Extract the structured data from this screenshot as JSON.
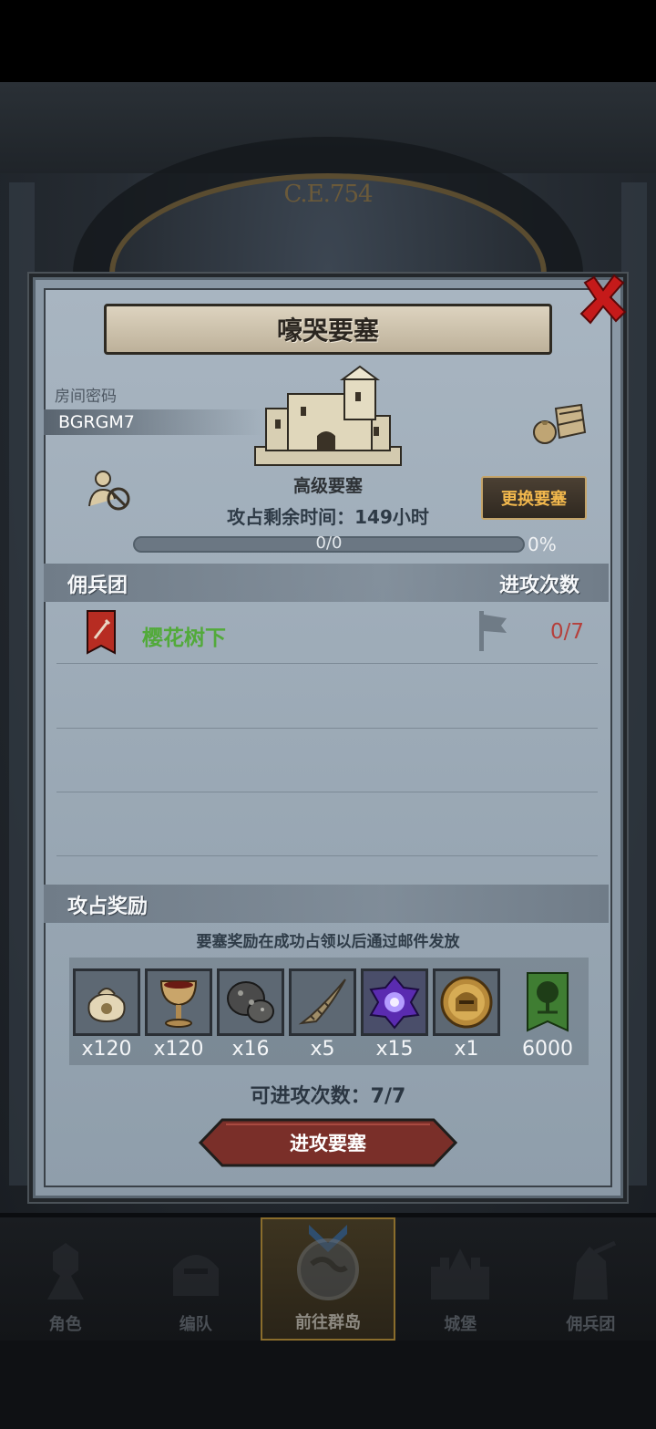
{
  "background": {
    "era_label": "C.E.754"
  },
  "dialog": {
    "title": "嚎哭要塞",
    "room_label": "房间密码",
    "room_code": "BGRGM7",
    "fortress_type": "高级要塞",
    "change_button": "更换要塞",
    "remaining_time": "攻占剩余时间：149小时",
    "progress": {
      "value": 0,
      "text": "0/0",
      "percent_text": "0%"
    },
    "mercenary_header": "佣兵团",
    "attacks_header": "进攻次数",
    "guilds": [
      {
        "name": "樱花树下",
        "attacks": "0/7"
      }
    ],
    "rewards_header": "攻占奖励",
    "rewards_note": "要塞奖励在成功占领以后通过邮件发放",
    "rewards": [
      {
        "icon": "coin-sack-icon",
        "qty": "x120"
      },
      {
        "icon": "goblet-icon",
        "qty": "x120"
      },
      {
        "icon": "ore-icon",
        "qty": "x16"
      },
      {
        "icon": "horn-icon",
        "qty": "x5"
      },
      {
        "icon": "purple-crystal-icon",
        "qty": "x15"
      },
      {
        "icon": "knight-medal-icon",
        "qty": "x1"
      },
      {
        "icon": "tree-banner-icon",
        "qty": "6000"
      }
    ],
    "attempts_left": "可进攻次数：7/7",
    "attack_button": "进攻要塞"
  },
  "nav": [
    {
      "label": "角色",
      "icon": "knight-icon"
    },
    {
      "label": "编队",
      "icon": "helmet-icon"
    },
    {
      "label": "前往群岛",
      "icon": "globe-icon",
      "active": true
    },
    {
      "label": "城堡",
      "icon": "castle-icon"
    },
    {
      "label": "佣兵团",
      "icon": "mercenary-icon"
    }
  ],
  "colors": {
    "guild_name": "#52aa3a",
    "guild_attacks": "#b5403c",
    "change_button_text": "#f2b84d",
    "attack_button": "#7a2f29"
  }
}
